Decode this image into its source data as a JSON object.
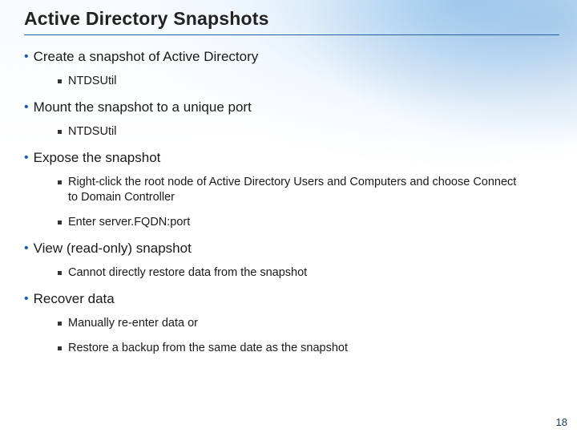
{
  "title": "Active Directory Snapshots",
  "bullets": [
    {
      "text": "Create a snapshot of Active Directory",
      "sub": [
        {
          "text": "NTDSUtil"
        }
      ]
    },
    {
      "text": "Mount the snapshot to a unique port",
      "sub": [
        {
          "text": "NTDSUtil"
        }
      ]
    },
    {
      "text": "Expose the snapshot",
      "sub": [
        {
          "text": "Right-click the root node of Active Directory Users and Computers and choose Connect to Domain Controller"
        },
        {
          "text": "Enter server.FQDN:port"
        }
      ]
    },
    {
      "text": "View (read-only) snapshot",
      "sub": [
        {
          "text": "Cannot directly restore data from the snapshot"
        }
      ]
    },
    {
      "text": "Recover data",
      "sub": [
        {
          "text": "Manually re-enter data or"
        },
        {
          "text": "Restore a backup from the same date as the snapshot"
        }
      ]
    }
  ],
  "page_number": "18"
}
